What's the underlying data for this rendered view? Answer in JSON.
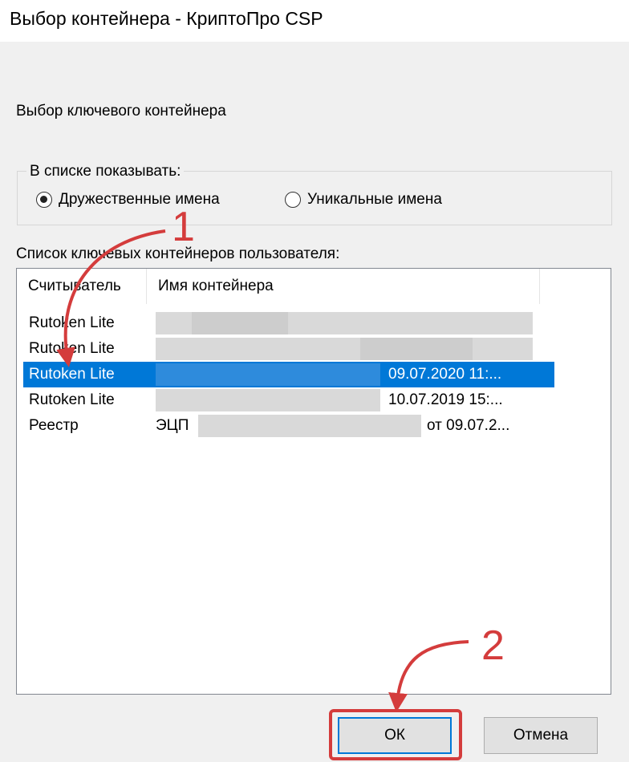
{
  "window": {
    "title": "Выбор контейнера - КриптоПро CSP"
  },
  "dialog": {
    "subtitle": "Выбор ключевого контейнера",
    "display_group": {
      "legend": "В списке показывать:",
      "options": [
        {
          "label": "Дружественные имена",
          "checked": true
        },
        {
          "label": "Уникальные имена",
          "checked": false
        }
      ]
    },
    "list": {
      "caption": "Список ключевых контейнеров пользователя:",
      "columns": [
        "Считыватель",
        "Имя контейнера"
      ],
      "rows": [
        {
          "reader": "Rutoken Lite",
          "name_prefix": "",
          "name_suffix": ""
        },
        {
          "reader": "Rutoken Lite",
          "name_prefix": "",
          "name_suffix": ""
        },
        {
          "reader": "Rutoken Lite",
          "name_prefix": "",
          "name_suffix": "09.07.2020 11:..."
        },
        {
          "reader": "Rutoken Lite",
          "name_prefix": "",
          "name_suffix": "10.07.2019 15:..."
        },
        {
          "reader": "Реестр",
          "name_prefix": "ЭЦП",
          "name_suffix": "от 09.07.2..."
        }
      ],
      "selected_index": 2
    },
    "buttons": {
      "ok": "ОК",
      "cancel": "Отмена"
    }
  },
  "annotations": {
    "step1": "1",
    "step2": "2",
    "color": "#d43c3c"
  },
  "colors": {
    "selection": "#0078d7",
    "dialog_bg": "#f0f0f0"
  }
}
